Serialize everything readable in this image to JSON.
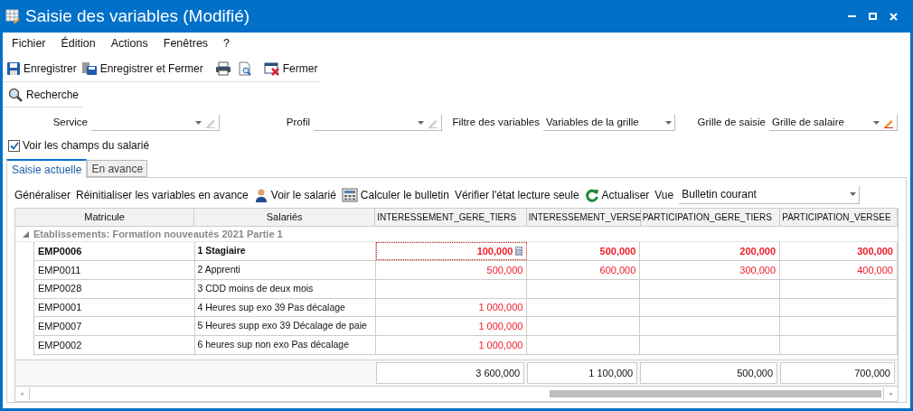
{
  "window": {
    "title": "Saisie des variables (Modifié)"
  },
  "menu": [
    "Fichier",
    "Édition",
    "Actions",
    "Fenêtres",
    "?"
  ],
  "toolbar": [
    {
      "kind": "save",
      "label": "Enregistrer"
    },
    {
      "kind": "save-close",
      "label": "Enregistrer et Fermer"
    },
    {
      "kind": "separator"
    },
    {
      "kind": "print"
    },
    {
      "kind": "preview"
    },
    {
      "kind": "separator"
    },
    {
      "kind": "close",
      "label": "Fermer"
    }
  ],
  "search_button": {
    "label": "Recherche"
  },
  "filters": [
    {
      "label": "Service",
      "kind": "editable-combo",
      "edit_enabled": false
    },
    {
      "label": "Profil",
      "kind": "editable-combo",
      "edit_enabled": false
    },
    {
      "label": "Filtre des variables",
      "kind": "combo",
      "value": "Variables de la grille"
    },
    {
      "label": "Grille de saisie",
      "kind": "editable-combo",
      "value": "Grille de salaire",
      "edit_enabled": true
    }
  ],
  "show_employee_fields": {
    "label": "Voir les champs du salarié",
    "checked": true
  },
  "tabs": [
    {
      "label": "Saisie actuelle",
      "selected": true
    },
    {
      "label": "En avance",
      "selected": false
    }
  ],
  "actions": [
    {
      "kind": "text",
      "label": "Généraliser"
    },
    {
      "kind": "text",
      "label": "Réinitialiser les variables en avance"
    },
    {
      "kind": "person",
      "label": "Voir le salarié"
    },
    {
      "kind": "calculator",
      "label": "Calculer le bulletin"
    },
    {
      "kind": "text",
      "label": "Vérifier l'état lecture seule"
    },
    {
      "kind": "refresh",
      "label": "Actualiser"
    }
  ],
  "view": {
    "label": "Vue",
    "value": "Bulletin courant"
  },
  "table": {
    "columns": [
      "Matricule",
      "Salariés",
      "INTERESSEMENT_GERE_TIERS",
      "INTERESSEMENT_VERSE",
      "PARTICIPATION_GERE_TIERS",
      "PARTICIPATION_VERSEE"
    ],
    "group": {
      "label": "Etablissements: Formation nouveautés 2021 Partie 1",
      "expanded": true
    },
    "rows": [
      {
        "id": "EMP0006",
        "name": "1 Stagiaire",
        "values": [
          "100,000",
          "500,000",
          "200,000",
          "300,000"
        ],
        "selected": true
      },
      {
        "id": "EMP0011",
        "name": "2 Apprenti",
        "values": [
          "500,000",
          "600,000",
          "300,000",
          "400,000"
        ],
        "selected": false
      },
      {
        "id": "EMP0028",
        "name": "3 CDD moins de deux mois",
        "selected": false
      },
      {
        "id": "EMP0001",
        "name": "4 Heures sup exo 39 Pas décalage",
        "values": [
          "1 000,000"
        ],
        "selected": false
      },
      {
        "id": "EMP0007",
        "name": "5 Heures supp exo 39 Décalage de paie",
        "values": [
          "1 000,000"
        ],
        "selected": false
      },
      {
        "id": "EMP0002",
        "name": "6 heures sup non exo Pas décalage",
        "values": [
          "1 000,000"
        ],
        "selected": false
      }
    ],
    "totals": [
      "3 600,000",
      "1 100,000",
      "500,000",
      "700,000"
    ]
  }
}
